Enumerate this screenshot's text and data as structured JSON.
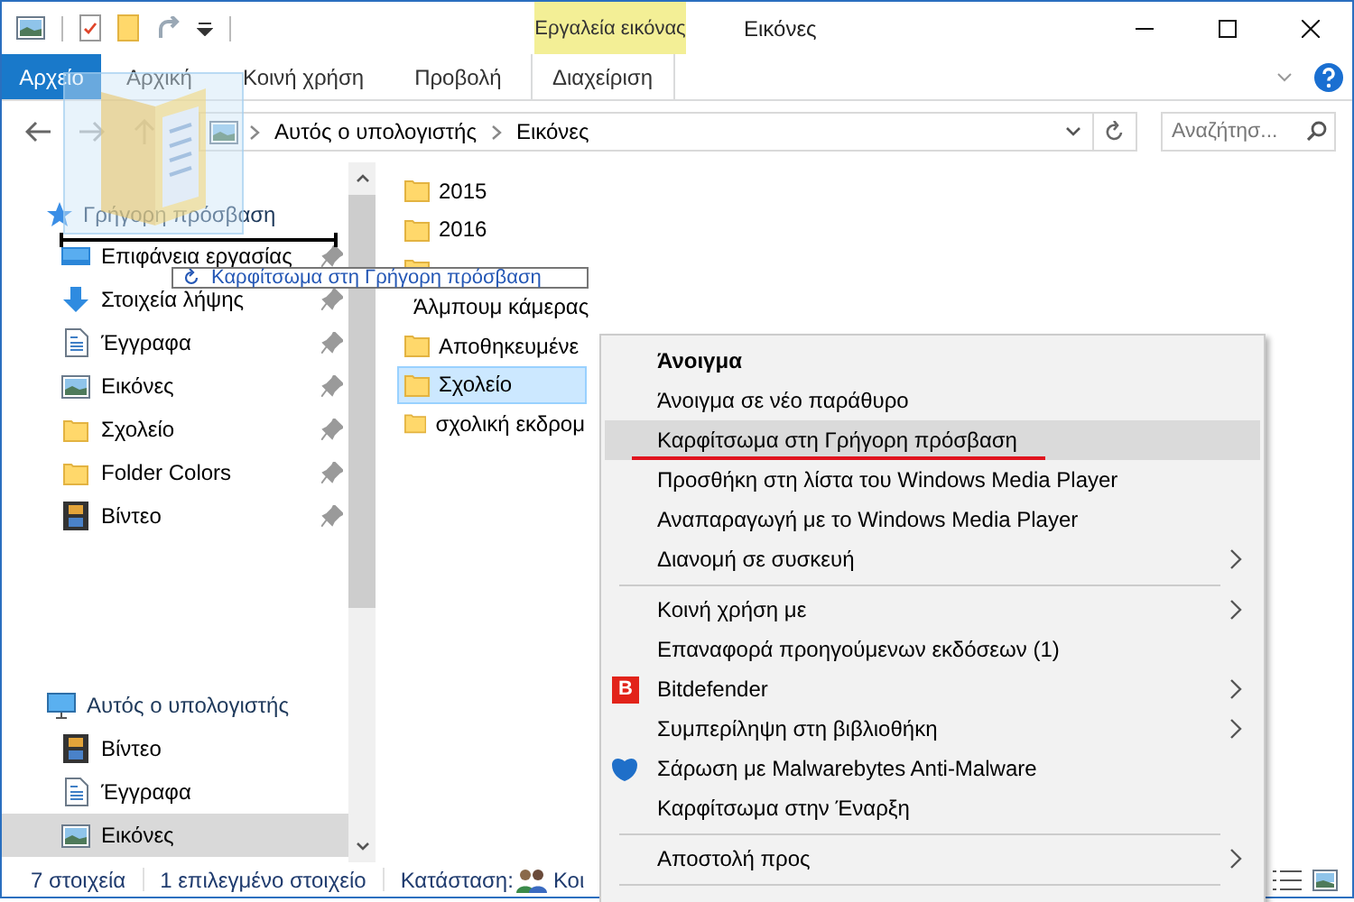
{
  "title_bar": {
    "contextual_group": "Εργαλεία εικόνας",
    "title": "Εικόνες"
  },
  "ribbon_tabs": [
    {
      "label": "Αρχείο",
      "kind": "file",
      "selected": false
    },
    {
      "label": "Αρχική",
      "kind": "normal",
      "selected": false
    },
    {
      "label": "Κοινή χρήση",
      "kind": "normal",
      "selected": false
    },
    {
      "label": "Προβολή",
      "kind": "normal",
      "selected": false
    },
    {
      "label": "Διαχείριση",
      "kind": "contextual",
      "selected": false
    }
  ],
  "address_bar": {
    "path": [
      "Αυτός ο υπολογιστής",
      "Εικόνες"
    ]
  },
  "search": {
    "placeholder": "Αναζήτησ..."
  },
  "navigation": {
    "quick_access": {
      "label": "Γρήγορη πρόσβαση",
      "items": [
        {
          "label": "Επιφάνεια εργασίας",
          "kind": "desktop",
          "pinned": true,
          "selected": false
        },
        {
          "label": "Στοιχεία λήψης",
          "kind": "downloads",
          "pinned": true,
          "selected": false
        },
        {
          "label": "Έγγραφα",
          "kind": "documents",
          "pinned": true,
          "selected": false
        },
        {
          "label": "Εικόνες",
          "kind": "pictures",
          "pinned": true,
          "selected": false
        },
        {
          "label": "Σχολείο",
          "kind": "folder",
          "pinned": true,
          "selected": false
        },
        {
          "label": "Folder Colors",
          "kind": "folder",
          "pinned": true,
          "selected": false
        },
        {
          "label": "Βίντεο",
          "kind": "videos",
          "pinned": true,
          "selected": false
        }
      ]
    },
    "this_pc": {
      "label": "Αυτός ο υπολογιστής",
      "items": [
        {
          "label": "Βίντεο",
          "kind": "videos",
          "selected": false
        },
        {
          "label": "Έγγραφα",
          "kind": "documents",
          "selected": false
        },
        {
          "label": "Εικόνες",
          "kind": "pictures",
          "selected": true
        }
      ]
    }
  },
  "files": [
    {
      "name": "2015",
      "selected": false
    },
    {
      "name": "2016",
      "selected": false
    },
    {
      "selected": false
    },
    {
      "name": "Άλμπουμ κάμερας",
      "selected": false
    },
    {
      "name": "Αποθηκευμένε",
      "selected": false
    },
    {
      "name": "Σχολείο",
      "selected": true
    },
    {
      "name": "σχολική εκδρομ",
      "selected": false
    }
  ],
  "drag_tooltip": {
    "text": "Καρφίτσωμα στη Γρήγορη πρόσβαση"
  },
  "context_menu": {
    "groups": [
      [
        {
          "label": "Άνοιγμα",
          "kind": "plain",
          "default": true,
          "submenu": false,
          "selected": false,
          "underlined": false
        },
        {
          "label": "Άνοιγμα σε νέο παράθυρο",
          "kind": "plain",
          "default": false,
          "submenu": false,
          "selected": false,
          "underlined": false
        },
        {
          "label": "Καρφίτσωμα στη Γρήγορη πρόσβαση",
          "kind": "plain",
          "default": false,
          "submenu": false,
          "selected": true,
          "underlined": true
        },
        {
          "label": "Προσθήκη στη λίστα του Windows Media Player",
          "kind": "plain",
          "default": false,
          "submenu": false,
          "selected": false,
          "underlined": false
        },
        {
          "label": "Αναπαραγωγή με το Windows Media Player",
          "kind": "plain",
          "default": false,
          "submenu": false,
          "selected": false,
          "underlined": false
        },
        {
          "label": "Διανομή σε συσκευή",
          "kind": "plain",
          "default": false,
          "submenu": true,
          "selected": false,
          "underlined": false
        }
      ],
      [
        {
          "label": "Κοινή χρήση με",
          "kind": "plain",
          "default": false,
          "submenu": true,
          "selected": false,
          "underlined": false
        },
        {
          "label": "Επαναφορά προηγούμενων εκδόσεων (1)",
          "kind": "plain",
          "default": false,
          "submenu": false,
          "selected": false,
          "underlined": false
        },
        {
          "label": "Bitdefender",
          "kind": "badge",
          "badge": "B",
          "default": false,
          "submenu": true,
          "selected": false,
          "underlined": false
        },
        {
          "label": "Συμπερίληψη στη βιβλιοθήκη",
          "kind": "plain",
          "default": false,
          "submenu": true,
          "selected": false,
          "underlined": false
        },
        {
          "label": "Σάρωση με Malwarebytes Anti-Malware",
          "kind": "logo",
          "default": false,
          "submenu": false,
          "selected": false,
          "underlined": false
        },
        {
          "label": "Καρφίτσωμα στην Έναρξη",
          "kind": "plain",
          "default": false,
          "submenu": false,
          "selected": false,
          "underlined": false
        }
      ],
      [
        {
          "label": "Αποστολή προς",
          "kind": "plain",
          "default": false,
          "submenu": true,
          "selected": false,
          "underlined": false
        }
      ]
    ]
  },
  "status_bar": {
    "item_count": "7 στοιχεία",
    "selection": "1 επιλεγμένο στοιχείο",
    "state_label": "Κατάσταση:",
    "state_value": "Κοι"
  }
}
